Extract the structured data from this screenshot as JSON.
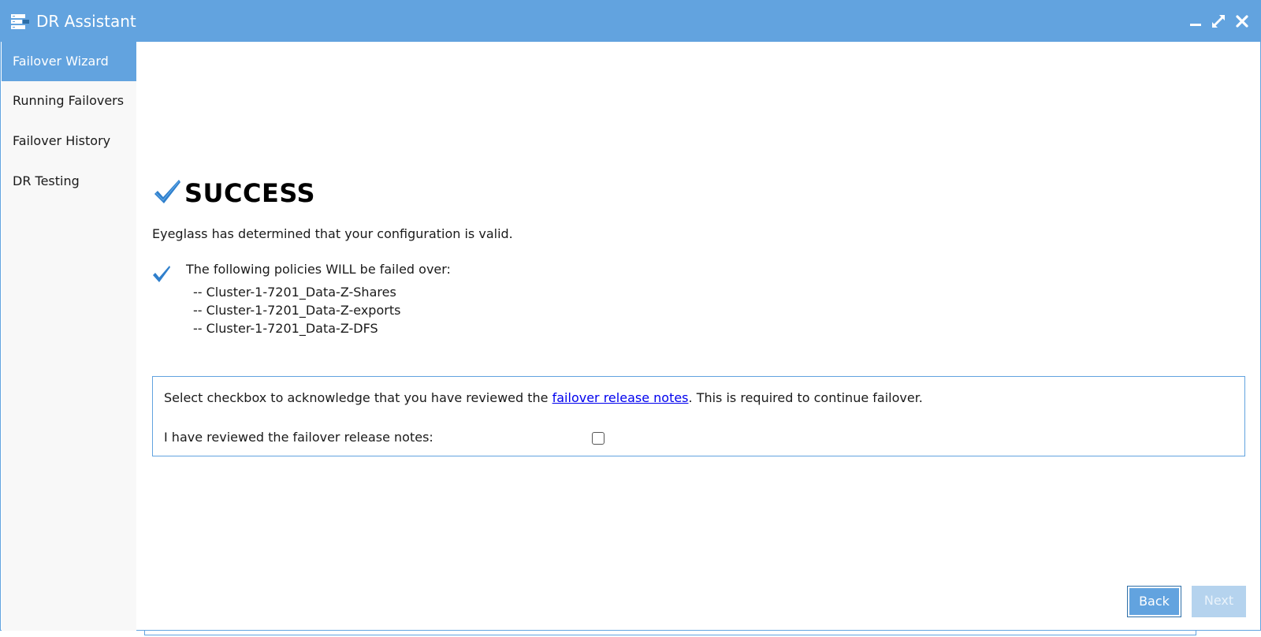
{
  "window": {
    "title": "DR Assistant",
    "accent_color": "#62a3df",
    "icons": {
      "app": "server-list-icon",
      "minimize": "minimize-icon",
      "maximize": "maximize-icon",
      "close": "close-icon"
    }
  },
  "sidebar": {
    "items": [
      {
        "label": "Failover Wizard",
        "active": true
      },
      {
        "label": "Running Failovers",
        "active": false
      },
      {
        "label": "Failover History",
        "active": false
      },
      {
        "label": "DR Testing",
        "active": false
      }
    ]
  },
  "main": {
    "status_title": "SUCCESS",
    "status_message": "Eyeglass has determined that your configuration is valid.",
    "policies_heading": "The following policies WILL be failed over:",
    "policies": [
      "-- Cluster-1-7201_Data-Z-Shares",
      "-- Cluster-1-7201_Data-Z-exports",
      "-- Cluster-1-7201_Data-Z-DFS"
    ],
    "acknowledge": {
      "text_before": "Select checkbox to acknowledge that you have reviewed the ",
      "link_text": "failover release notes",
      "text_after": ". This is required to continue failover.",
      "checkbox_label": "I have reviewed the failover release notes:",
      "checked": false
    }
  },
  "buttons": {
    "back": "Back",
    "next": "Next"
  }
}
